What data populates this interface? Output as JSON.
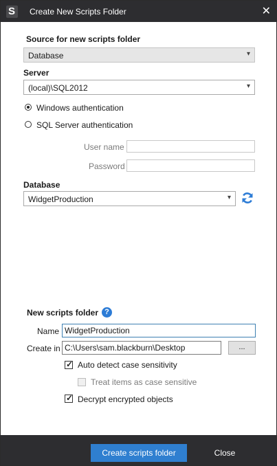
{
  "window": {
    "title": "Create New Scripts Folder"
  },
  "source": {
    "label": "Source for new scripts folder",
    "value": "Database"
  },
  "server": {
    "label": "Server",
    "value": "(local)\\SQL2012"
  },
  "auth": {
    "windows_label": "Windows authentication",
    "sql_label": "SQL Server authentication",
    "selected": "windows",
    "username_label": "User name",
    "password_label": "Password"
  },
  "database": {
    "label": "Database",
    "value": "WidgetProduction"
  },
  "scripts_folder": {
    "heading": "New scripts folder",
    "name_label": "Name",
    "name_value": "WidgetProduction",
    "create_in_label": "Create in",
    "create_in_value": "C:\\Users\\sam.blackburn\\Desktop",
    "browse_label": "..."
  },
  "options": {
    "auto_detect": {
      "label": "Auto detect case sensitivity",
      "checked": true
    },
    "case_sensitive": {
      "label": "Treat items as case sensitive",
      "checked": false,
      "disabled": true
    },
    "decrypt": {
      "label": "Decrypt encrypted objects",
      "checked": true
    }
  },
  "footer": {
    "create_label": "Create scripts folder",
    "close_label": "Close"
  },
  "colors": {
    "titlebar": "#2d2d30",
    "accent": "#2f7fd0"
  }
}
